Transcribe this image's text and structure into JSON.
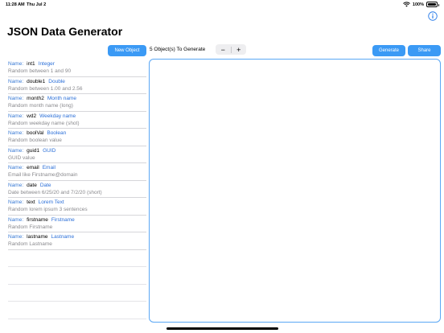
{
  "status": {
    "time": "11:28 AM",
    "date": "Thu Jul 2",
    "battery": "100%"
  },
  "title": "JSON Data Generator",
  "toolbar": {
    "new_object": "New Object",
    "count_label": "5 Object(s) To Generate",
    "minus": "−",
    "plus": "+",
    "generate": "Generate",
    "share": "Share"
  },
  "field_label": "Name:",
  "fields": [
    {
      "name": "int1",
      "type": "Integer",
      "desc": "Random between 1 and 90"
    },
    {
      "name": "double1",
      "type": "Double",
      "desc": "Random between 1.00 and 2.56"
    },
    {
      "name": "month2",
      "type": "Month name",
      "desc": "Random month name (long)"
    },
    {
      "name": "wd2",
      "type": "Weekday name",
      "desc": "Random weekday name (shot)"
    },
    {
      "name": "boolVal",
      "type": "Boolean",
      "desc": "Random boolean value"
    },
    {
      "name": "guid1",
      "type": "GUID",
      "desc": "GUID value"
    },
    {
      "name": "email",
      "type": "Email",
      "desc": "Email like  Firstname@domain"
    },
    {
      "name": "date",
      "type": "Date",
      "desc": "Date between 6/25/20 and 7/2/20 (short)"
    },
    {
      "name": "text",
      "type": "Lorem Text",
      "desc": "Random lorem ipsum 3 sentences"
    },
    {
      "name": "firstname",
      "type": "Firstname",
      "desc": "Random Firstname"
    },
    {
      "name": "lastname",
      "type": "Lastname",
      "desc": "Random Lastname"
    }
  ],
  "empty_rows": 4,
  "colors": {
    "accent": "#3b9af5",
    "link": "#2b6fd8",
    "secondary_text": "#8a8a8e"
  },
  "icons": [
    "wifi-icon",
    "battery-icon",
    "info-icon"
  ]
}
